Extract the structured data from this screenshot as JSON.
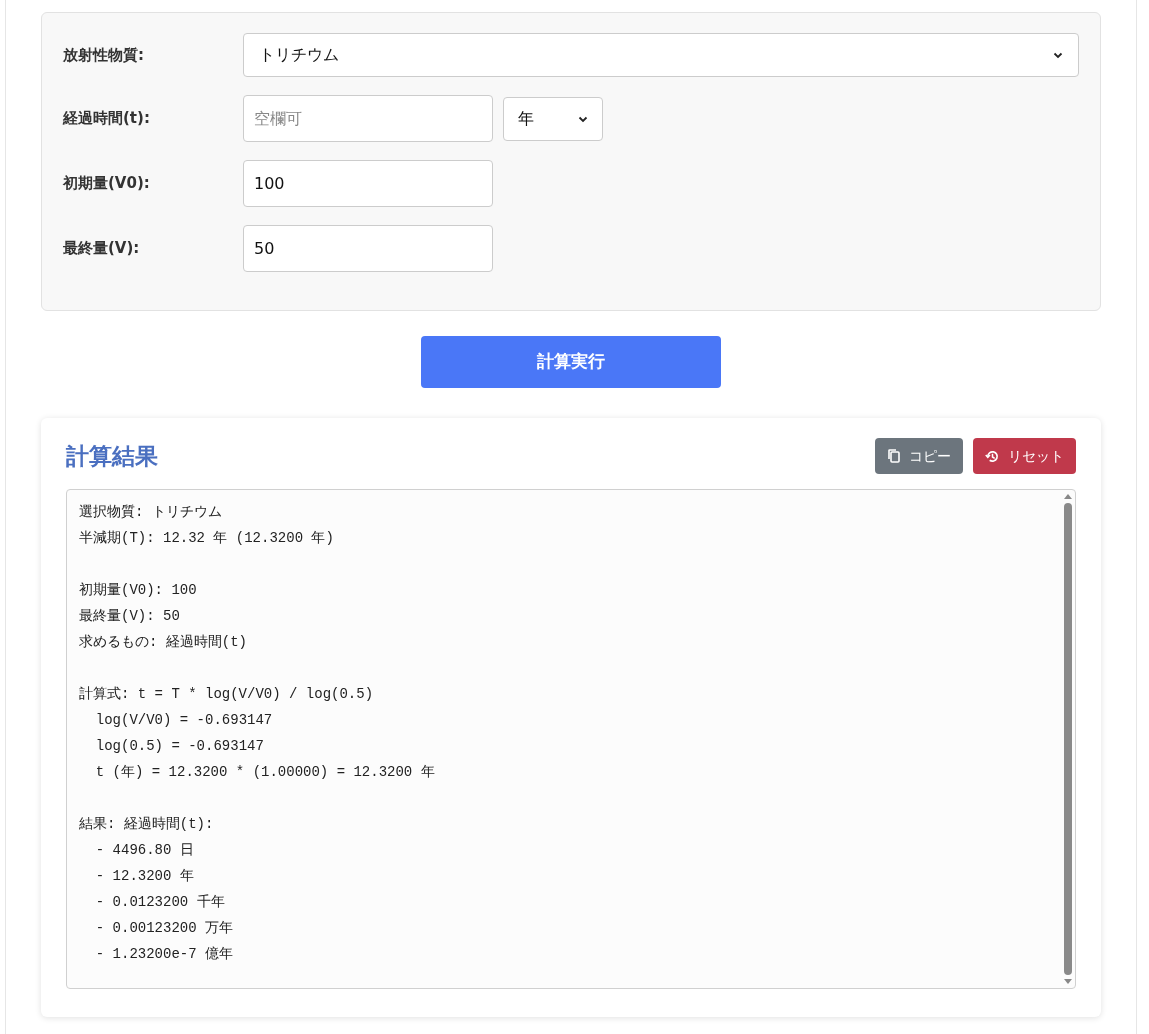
{
  "form": {
    "substance": {
      "label": "放射性物質:",
      "value": "トリチウム"
    },
    "elapsed": {
      "label": "経過時間(t):",
      "placeholder": "空欄可",
      "unit": "年"
    },
    "initial": {
      "label": "初期量(V0):",
      "value": "100"
    },
    "final": {
      "label": "最終量(V):",
      "value": "50"
    }
  },
  "run_button": "計算実行",
  "result": {
    "title": "計算結果",
    "copy_button": "コピー",
    "reset_button": "リセット",
    "paragraphs": [
      [
        "選択物質: トリチウム",
        "半減期(T): 12.32 年 (12.3200 年)"
      ],
      [
        "初期量(V0): 100",
        "最終量(V): 50",
        "求めるもの: 経過時間(t)"
      ],
      [
        "計算式: t = T * log(V/V0) / log(0.5)",
        "  log(V/V0) = -0.693147",
        "  log(0.5) = -0.693147",
        "  t (年) = 12.3200 * (1.00000) = 12.3200 年"
      ],
      [
        "結果: 経過時間(t):",
        "  - 4496.80 日",
        "  - 12.3200 年",
        "  - 0.0123200 千年",
        "  - 0.00123200 万年",
        "  - 1.23200e-7 億年"
      ]
    ]
  }
}
